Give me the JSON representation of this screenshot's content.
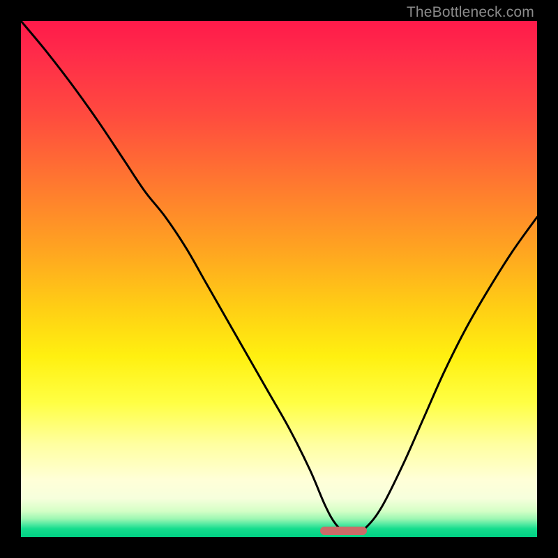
{
  "watermark": {
    "text": "TheBottleneck.com"
  },
  "colors": {
    "bg": "#000000",
    "curve": "#000000",
    "marker": "#cc6b68",
    "gradient_stops": [
      "#ff1a4a",
      "#ff2a4a",
      "#ff4a3f",
      "#ff7a2f",
      "#ffa321",
      "#ffd014",
      "#fff010",
      "#ffff44",
      "#ffffa0",
      "#ffffd8",
      "#f6ffdc",
      "#d4ffc6",
      "#9bf7b2",
      "#4de8a0",
      "#15dd8d",
      "#00d084"
    ]
  },
  "chart_data": {
    "type": "line",
    "title": "",
    "xlabel": "",
    "ylabel": "",
    "xlim": [
      0,
      100
    ],
    "ylim": [
      0,
      100
    ],
    "grid": false,
    "legend": false,
    "annotations": [
      {
        "name": "optimum-marker",
        "x_start": 58,
        "x_end": 67,
        "y": 1.2
      }
    ],
    "series": [
      {
        "name": "bottleneck-curve",
        "x": [
          0,
          5,
          10,
          15,
          20,
          24,
          28,
          32,
          36,
          40,
          44,
          48,
          52,
          56,
          59,
          61,
          63,
          65,
          67,
          70,
          74,
          78,
          82,
          86,
          90,
          95,
          100
        ],
        "y": [
          100,
          94,
          87.5,
          80.5,
          73,
          67,
          62,
          56,
          49,
          42,
          35,
          28,
          21,
          13,
          6,
          2.5,
          1,
          1,
          2,
          6,
          14,
          23,
          32,
          40,
          47,
          55,
          62
        ]
      }
    ]
  }
}
